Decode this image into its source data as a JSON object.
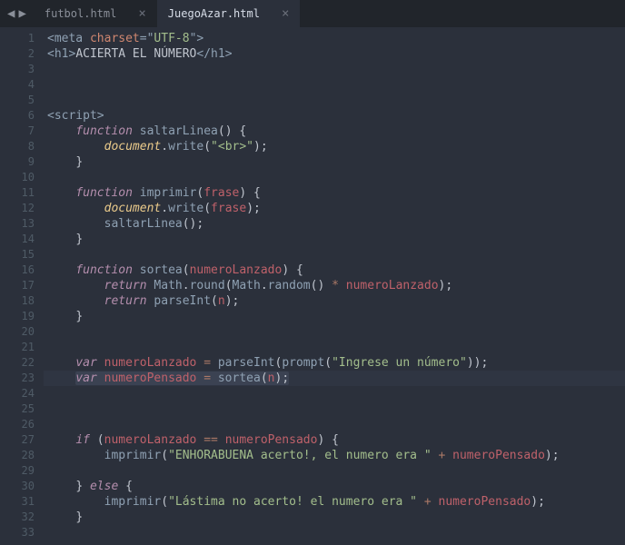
{
  "nav": {
    "back": "◀",
    "forward": "▶"
  },
  "tabs": [
    {
      "label": "futbol.html",
      "active": false
    },
    {
      "label": "JuegoAzar.html",
      "active": true
    }
  ],
  "lineNumbers": [
    "1",
    "2",
    "3",
    "4",
    "5",
    "6",
    "7",
    "8",
    "9",
    "10",
    "11",
    "12",
    "13",
    "14",
    "15",
    "16",
    "17",
    "18",
    "19",
    "20",
    "21",
    "22",
    "23",
    "24",
    "25",
    "26",
    "27",
    "28",
    "29",
    "30",
    "31",
    "32",
    "33"
  ],
  "code": [
    [
      [
        "t-pun",
        "<"
      ],
      [
        "t-tag",
        "meta"
      ],
      [
        "t-txt",
        " "
      ],
      [
        "t-attr",
        "charset"
      ],
      [
        "t-pun",
        "="
      ],
      [
        "t-pun",
        "\""
      ],
      [
        "t-str",
        "UTF-8"
      ],
      [
        "t-pun",
        "\""
      ],
      [
        "t-pun",
        ">"
      ]
    ],
    [
      [
        "t-pun",
        "<"
      ],
      [
        "t-tag",
        "h1"
      ],
      [
        "t-pun",
        ">"
      ],
      [
        "t-txt",
        "ACIERTA EL NÚMERO"
      ],
      [
        "t-pun",
        "</"
      ],
      [
        "t-tag",
        "h1"
      ],
      [
        "t-pun",
        ">"
      ]
    ],
    [],
    [],
    [],
    [
      [
        "t-pun",
        "<"
      ],
      [
        "t-tag",
        "script"
      ],
      [
        "t-pun",
        ">"
      ]
    ],
    [
      [
        "t-txt",
        "    "
      ],
      [
        "t-kw",
        "function"
      ],
      [
        "t-txt",
        " "
      ],
      [
        "t-fn",
        "saltarLinea"
      ],
      [
        "t-upun",
        "("
      ],
      [
        "t-upun",
        ")"
      ],
      [
        "t-txt",
        " "
      ],
      [
        "t-upun",
        "{"
      ]
    ],
    [
      [
        "t-txt",
        "        "
      ],
      [
        "t-doc",
        "document"
      ],
      [
        "t-upun",
        "."
      ],
      [
        "t-fn",
        "write"
      ],
      [
        "t-upun",
        "("
      ],
      [
        "t-str",
        "\"<br>\""
      ],
      [
        "t-upun",
        ")"
      ],
      [
        "t-upun",
        ";"
      ]
    ],
    [
      [
        "t-txt",
        "    "
      ],
      [
        "t-upun",
        "}"
      ]
    ],
    [],
    [
      [
        "t-txt",
        "    "
      ],
      [
        "t-kw",
        "function"
      ],
      [
        "t-txt",
        " "
      ],
      [
        "t-fn",
        "imprimir"
      ],
      [
        "t-upun",
        "("
      ],
      [
        "t-var",
        "frase"
      ],
      [
        "t-upun",
        ")"
      ],
      [
        "t-txt",
        " "
      ],
      [
        "t-upun",
        "{"
      ]
    ],
    [
      [
        "t-txt",
        "        "
      ],
      [
        "t-doc",
        "document"
      ],
      [
        "t-upun",
        "."
      ],
      [
        "t-fn",
        "write"
      ],
      [
        "t-upun",
        "("
      ],
      [
        "t-var",
        "frase"
      ],
      [
        "t-upun",
        ")"
      ],
      [
        "t-upun",
        ";"
      ]
    ],
    [
      [
        "t-txt",
        "        "
      ],
      [
        "t-fn",
        "saltarLinea"
      ],
      [
        "t-upun",
        "("
      ],
      [
        "t-upun",
        ")"
      ],
      [
        "t-upun",
        ";"
      ]
    ],
    [
      [
        "t-txt",
        "    "
      ],
      [
        "t-upun",
        "}"
      ]
    ],
    [],
    [
      [
        "t-txt",
        "    "
      ],
      [
        "t-kw",
        "function"
      ],
      [
        "t-txt",
        " "
      ],
      [
        "t-fn",
        "sortea"
      ],
      [
        "t-upun",
        "("
      ],
      [
        "t-var",
        "numeroLanzado"
      ],
      [
        "t-upun",
        ")"
      ],
      [
        "t-txt",
        " "
      ],
      [
        "t-upun",
        "{"
      ]
    ],
    [
      [
        "t-txt",
        "        "
      ],
      [
        "t-kw",
        "return"
      ],
      [
        "t-txt",
        " "
      ],
      [
        "t-prop",
        "Math"
      ],
      [
        "t-upun",
        "."
      ],
      [
        "t-fn",
        "round"
      ],
      [
        "t-upun",
        "("
      ],
      [
        "t-prop",
        "Math"
      ],
      [
        "t-upun",
        "."
      ],
      [
        "t-fn",
        "random"
      ],
      [
        "t-upun",
        "("
      ],
      [
        "t-upun",
        ")"
      ],
      [
        "t-txt",
        " "
      ],
      [
        "t-op",
        "*"
      ],
      [
        "t-txt",
        " "
      ],
      [
        "t-var",
        "numeroLanzado"
      ],
      [
        "t-upun",
        ")"
      ],
      [
        "t-upun",
        ";"
      ]
    ],
    [
      [
        "t-txt",
        "        "
      ],
      [
        "t-kw",
        "return"
      ],
      [
        "t-txt",
        " "
      ],
      [
        "t-fn",
        "parseInt"
      ],
      [
        "t-upun",
        "("
      ],
      [
        "t-var",
        "n"
      ],
      [
        "t-upun",
        ")"
      ],
      [
        "t-upun",
        ";"
      ]
    ],
    [
      [
        "t-txt",
        "    "
      ],
      [
        "t-upun",
        "}"
      ]
    ],
    [],
    [],
    [
      [
        "t-txt",
        "    "
      ],
      [
        "t-kw",
        "var"
      ],
      [
        "t-txt",
        " "
      ],
      [
        "t-var",
        "numeroLanzado"
      ],
      [
        "t-txt",
        " "
      ],
      [
        "t-op",
        "="
      ],
      [
        "t-txt",
        " "
      ],
      [
        "t-fn",
        "parseInt"
      ],
      [
        "t-upun",
        "("
      ],
      [
        "t-fn",
        "prompt"
      ],
      [
        "t-upun",
        "("
      ],
      [
        "t-str",
        "\"Ingrese un número\""
      ],
      [
        "t-upun",
        ")"
      ],
      [
        "t-upun",
        ")"
      ],
      [
        "t-upun",
        ";"
      ]
    ],
    [
      [
        "t-txt",
        "    "
      ],
      [
        "sel-start",
        ""
      ],
      [
        "t-kw",
        "var"
      ],
      [
        "t-txt",
        " "
      ],
      [
        "t-var",
        "numeroPensado"
      ],
      [
        "t-txt",
        " "
      ],
      [
        "t-op",
        "="
      ],
      [
        "t-txt",
        " "
      ],
      [
        "t-fn",
        "sortea"
      ],
      [
        "t-upun",
        "("
      ],
      [
        "t-var",
        "n"
      ],
      [
        "t-upun",
        ")"
      ],
      [
        "t-upun",
        ";"
      ],
      [
        "sel-end",
        ""
      ]
    ],
    [],
    [],
    [],
    [
      [
        "t-txt",
        "    "
      ],
      [
        "t-kw",
        "if"
      ],
      [
        "t-txt",
        " "
      ],
      [
        "t-upun",
        "("
      ],
      [
        "t-var",
        "numeroLanzado"
      ],
      [
        "t-txt",
        " "
      ],
      [
        "t-op",
        "=="
      ],
      [
        "t-txt",
        " "
      ],
      [
        "t-var",
        "numeroPensado"
      ],
      [
        "t-upun",
        ")"
      ],
      [
        "t-txt",
        " "
      ],
      [
        "t-upun",
        "{"
      ]
    ],
    [
      [
        "t-txt",
        "        "
      ],
      [
        "t-fn",
        "imprimir"
      ],
      [
        "t-upun",
        "("
      ],
      [
        "t-str",
        "\"ENHORABUENA acerto!, el numero era \""
      ],
      [
        "t-txt",
        " "
      ],
      [
        "t-op",
        "+"
      ],
      [
        "t-txt",
        " "
      ],
      [
        "t-var",
        "numeroPensado"
      ],
      [
        "t-upun",
        ")"
      ],
      [
        "t-upun",
        ";"
      ]
    ],
    [],
    [
      [
        "t-txt",
        "    "
      ],
      [
        "t-upun",
        "}"
      ],
      [
        "t-txt",
        " "
      ],
      [
        "t-kw",
        "else"
      ],
      [
        "t-txt",
        " "
      ],
      [
        "t-upun",
        "{"
      ]
    ],
    [
      [
        "t-txt",
        "        "
      ],
      [
        "t-fn",
        "imprimir"
      ],
      [
        "t-upun",
        "("
      ],
      [
        "t-str",
        "\"Lástima no acerto! el numero era \""
      ],
      [
        "t-txt",
        " "
      ],
      [
        "t-op",
        "+"
      ],
      [
        "t-txt",
        " "
      ],
      [
        "t-var",
        "numeroPensado"
      ],
      [
        "t-upun",
        ")"
      ],
      [
        "t-upun",
        ";"
      ]
    ],
    [
      [
        "t-txt",
        "    "
      ],
      [
        "t-upun",
        "}"
      ]
    ],
    []
  ],
  "highlightedLine": 23
}
